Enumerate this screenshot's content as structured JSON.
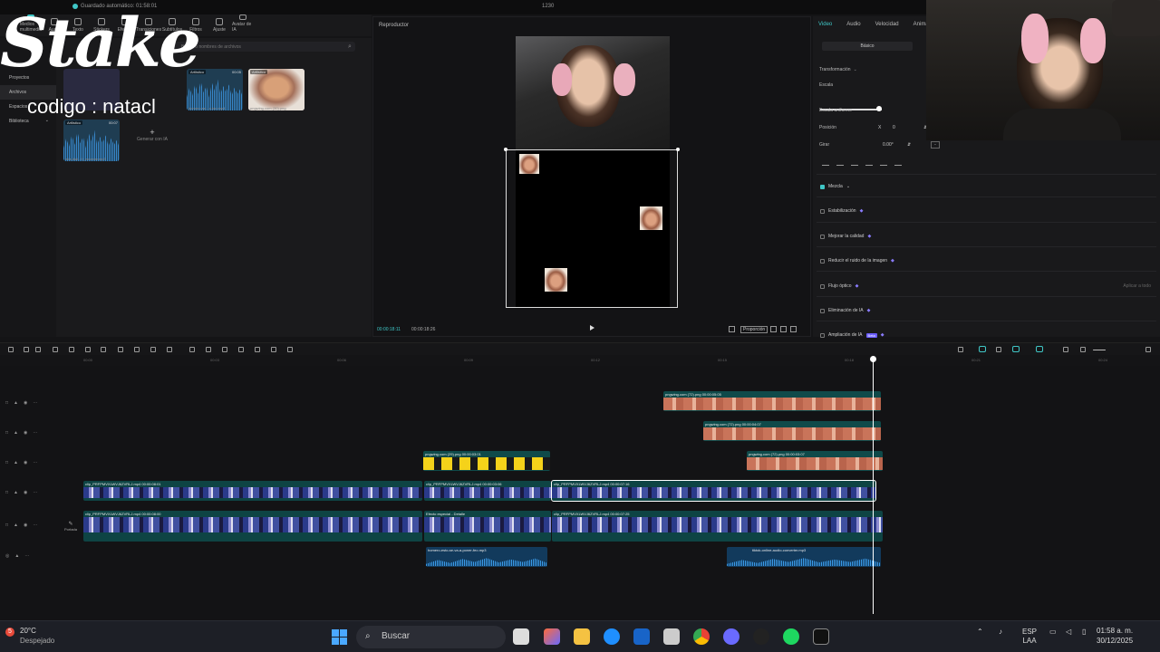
{
  "titlebar": {
    "autosave": "Guardado automático: 01:58:01",
    "center": "1230"
  },
  "topnav": [
    {
      "label": "Medios multimedia",
      "active": true
    },
    {
      "label": "Audio"
    },
    {
      "label": "Texto"
    },
    {
      "label": "Stickers"
    },
    {
      "label": "Efectos"
    },
    {
      "label": "Transiciones"
    },
    {
      "label": "Subtítulos"
    },
    {
      "label": "Filtros"
    },
    {
      "label": "Ajuste"
    },
    {
      "label": "Avatar de IA"
    }
  ],
  "sidebar": [
    {
      "label": "Proyectos",
      "chev": ""
    },
    {
      "label": "Archivos",
      "chev": ""
    },
    {
      "label": "Espacios",
      "chev": "⌄"
    },
    {
      "label": "Biblioteca",
      "chev": "⌄"
    }
  ],
  "media": {
    "search_placeholder": "Busca o nombres de archivos",
    "items": [
      {
        "tag": "Artlistico",
        "dur": "00:05",
        "caption": "homero-se...o-fan.mp4"
      },
      {
        "tag": "Artlistico",
        "dur": "",
        "caption": "pngwing.com (30).png"
      },
      {
        "tag": "Artlistico",
        "dur": "00:07",
        "caption": "mia-dial...0_zwordar.mp3"
      }
    ],
    "generate_label": "Generar con IA"
  },
  "overlay": {
    "logo": "Stake",
    "code": "codigo : natacl"
  },
  "player": {
    "title": "Reproductor",
    "time_current": "00:00:18:11",
    "time_total": "00:00:18:26",
    "ratio": "Proporción"
  },
  "props": {
    "tabs": [
      {
        "label": "Video",
        "active": true
      },
      {
        "label": "Audio"
      },
      {
        "label": "Velocidad"
      },
      {
        "label": "Animación"
      }
    ],
    "basic": "Básico",
    "transform": "Transformación",
    "scale": "Escala",
    "uniform_scale": "Escala uniforme",
    "position": "Posición",
    "position_x": "0",
    "position_y": "0",
    "rotate": "Girar",
    "rotate_value": "0.00°",
    "scale_fraction": 0.95,
    "sections": [
      {
        "label": "Mezcla",
        "checked": true,
        "gem": false
      },
      {
        "label": "Estabilización",
        "checked": false,
        "gem": true
      },
      {
        "label": "Mejorar la calidad",
        "checked": false,
        "gem": true
      },
      {
        "label": "Reducir el ruido de la imagen",
        "checked": false,
        "gem": true
      },
      {
        "label": "Flujo óptico",
        "checked": false,
        "gem": true
      },
      {
        "label": "Eliminación de IA",
        "checked": false,
        "gem": true
      },
      {
        "label": "Ampliación de IA",
        "checked": false,
        "gem": true,
        "badge": "Beta"
      }
    ],
    "apply_all": "Aplicar a todo"
  },
  "ruler": [
    "00:00",
    "00:03",
    "00:06",
    "00:09",
    "00:12",
    "00:15",
    "00:18",
    "00:21",
    "00:24"
  ],
  "timeline": {
    "cover": "Portada",
    "clips": [
      {
        "label": "pngwing.com (72).png 00:00:05:05",
        "kind": "meme"
      },
      {
        "label": "pngwing.com (72).png 00:00:04:07",
        "kind": "meme"
      },
      {
        "label": "pngwing.com (29).png 00:00:03:01",
        "kind": "duck"
      },
      {
        "label": "pngwing.com (72).png 00:00:03:07",
        "kind": "meme"
      },
      {
        "label": "clip_PRFPMVXLWVJ6ZVRLJ.mp4 00:00:08:01",
        "kind": "video"
      },
      {
        "label": "clip_PRFPMVXLWVJ6ZVRLJ.mp4 00:00:03:06",
        "kind": "video"
      },
      {
        "label": "clip_PRFPMVXLWVJ6ZVRLJ.mp4 00:00:07:16",
        "kind": "video"
      },
      {
        "label": "clip_PRFPMVXLWVJ6ZVRLJ.mp4 00:00:08:00",
        "kind": "video"
      },
      {
        "label": "Efecto especial - Detalle",
        "kind": "video"
      },
      {
        "label": "clip_PRFPMVXLWVJ6ZVRLJ.mp4 00:00:07:25",
        "kind": "video"
      },
      {
        "label": "homero-esto-se-va-a-poner-feo.mp3",
        "kind": "audio"
      },
      {
        "label": "tiktok-online-audio-converter.mp3",
        "kind": "audio"
      }
    ]
  },
  "taskbar": {
    "weather_temp": "20°C",
    "weather_desc": "Despejado",
    "weather_badge": "5",
    "search": "Buscar",
    "lang1": "ESP",
    "lang2": "LAA",
    "time": "01:58 a. m.",
    "date": "30/12/2025"
  }
}
